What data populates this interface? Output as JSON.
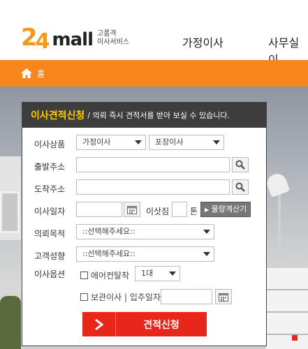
{
  "header": {
    "logo": {
      "num2": "2",
      "num4": "4",
      "mall": "mall",
      "tagline1": "고품격",
      "tagline2": "이사서비스"
    },
    "nav": [
      "가정이사",
      "사무실이"
    ]
  },
  "breadcrumb": {
    "home_label": "홈"
  },
  "form": {
    "title": "이사견적신청",
    "subtitle": "/ 의뢰 즉시 견적서를 받아 보실 수 있습니다.",
    "labels": {
      "product": "이사상품",
      "origin": "출발주소",
      "destination": "도착주소",
      "date": "이사일자",
      "cargo": "이삿짐",
      "ton": "톤",
      "purpose": "의뢰목적",
      "customer": "고객성향",
      "option": "이사옵션"
    },
    "product_type": "가정이사",
    "pack_type": "포장이사",
    "calc_button": "물량계산기",
    "purpose_select": "::선택해주세요::",
    "customer_select": "::선택해주세요::",
    "aircon_label": "에어컨탈착",
    "aircon_qty": "1대",
    "storage_label": "보관이사 | 입주일자",
    "submit_label": "견적신청"
  },
  "colors": {
    "accent_orange": "#f7871d",
    "panel_header": "#3d3d3d",
    "title_yellow": "#ffcc00",
    "submit_red": "#e8261a"
  }
}
